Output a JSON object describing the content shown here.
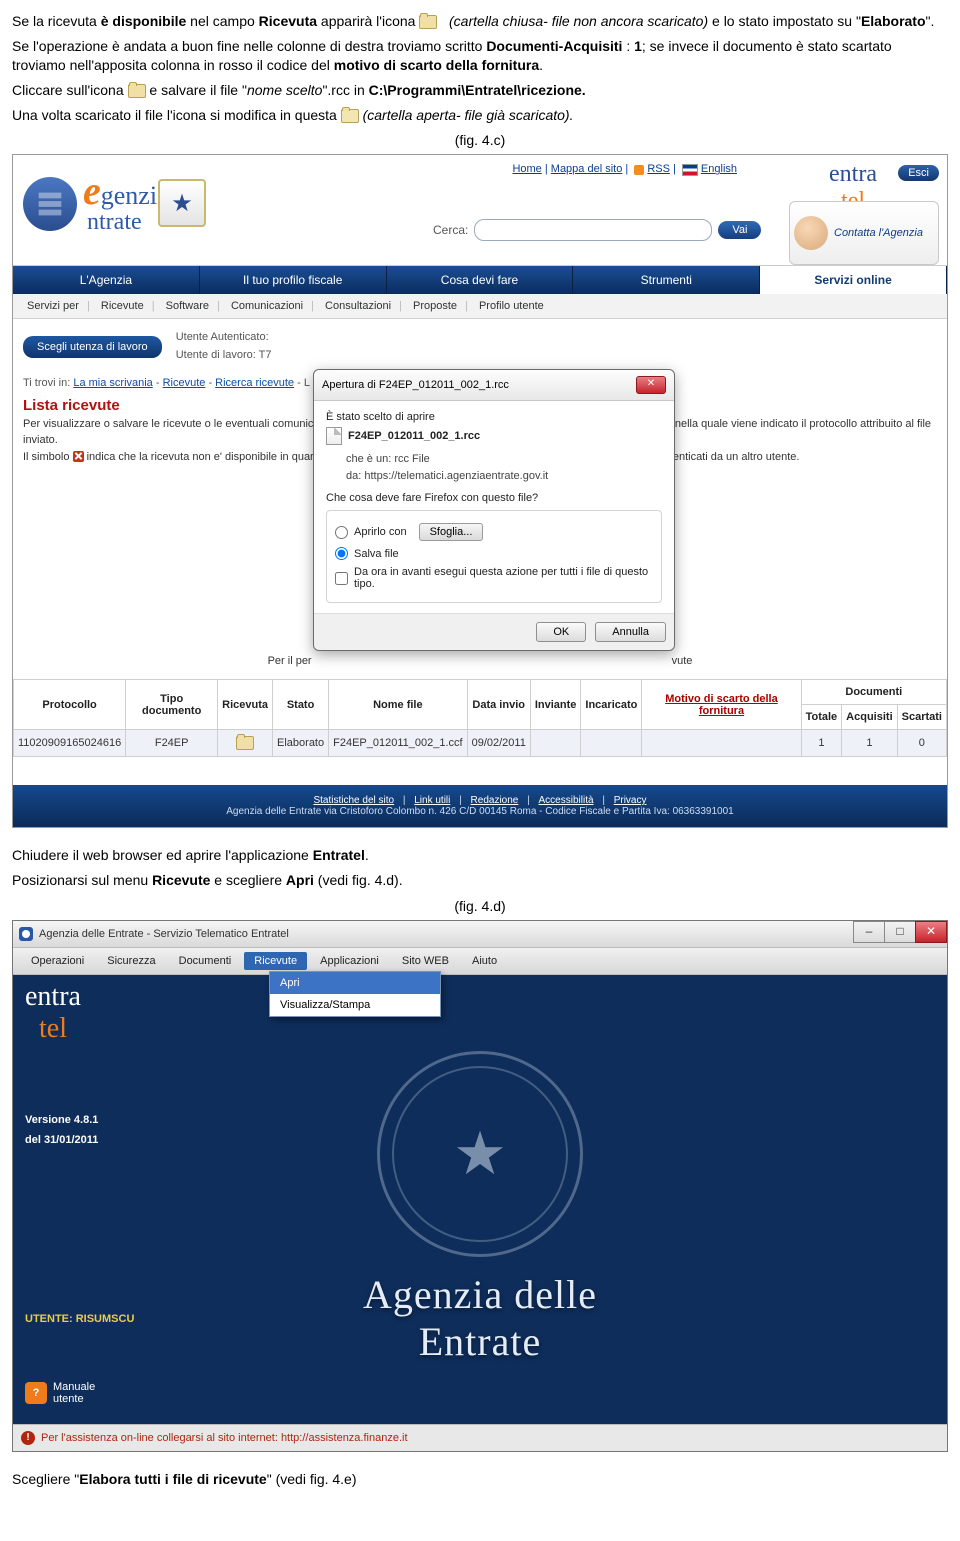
{
  "intro": {
    "p1a": "Se la ricevuta ",
    "p1b": "è disponibile",
    "p1c": " nel campo ",
    "p1d": "Ricevuta",
    "p1e": " apparirà l'icona ",
    "p1f": "(cartella chiusa- file non ancora scaricato)",
    "p1g": " e lo stato impostato su \"",
    "p1h": "Elaborato",
    "p1i": "\".",
    "p2a": "Se l'operazione è andata a buon fine nelle colonne di destra troviamo scritto ",
    "p2b": "Documenti-Acquisiti",
    "p2c": " : ",
    "p2d": "1",
    "p2e": "; se invece il documento è stato scartato troviamo nell'apposita colonna in rosso il codice del ",
    "p2f": "motivo di scarto della fornitura",
    "p2g": ".",
    "p3a": "Cliccare sull'icona ",
    "p3b": " e salvare il file \"",
    "p3c": "nome scelto",
    "p3d": "\".rcc in ",
    "p3e": "C:\\Programmi\\Entratel\\ricezione.",
    "p4a": "Una volta scaricato il file l'icona si modifica in questa ",
    "p4b": "(cartella aperta- file già scaricato)."
  },
  "figc_caption": "(fig. 4.c)",
  "top_links": {
    "home": "Home",
    "mappa": "Mappa del sito",
    "rss": "RSS",
    "english": "English"
  },
  "entra_logo": {
    "a": "entra",
    "b": "tel"
  },
  "esci": "Esci",
  "cerca_label": "Cerca:",
  "vai": "Vai",
  "contatta": "Contatta l'Agenzia",
  "navtabs": [
    "L'Agenzia",
    "Il tuo profilo fiscale",
    "Cosa devi fare",
    "Strumenti",
    "Servizi online"
  ],
  "subnav": [
    "Servizi per",
    "Ricevute",
    "Software",
    "Comunicazioni",
    "Consultazioni",
    "Proposte",
    "Profilo utente"
  ],
  "scegli": "Scegli utenza di lavoro",
  "auth": {
    "l1": "Utente Autenticato:",
    "l2": "Utente di lavoro: T7"
  },
  "breadcrumb": {
    "pre": "Ti trovi in: ",
    "a": "La mia scrivania",
    "b": "Ricevute",
    "c": "Ricerca ricevute",
    "d": " - L"
  },
  "lista_title": "Lista ricevute",
  "info": {
    "l1": "Per visualizzare o salvare le ricevute o le eventuali comunica",
    "l1b": "ga nella quale viene indicato il protocollo attribuito al file inviato.",
    "l2a": "Il simbolo ",
    "l2b": " indica che la ricevuta non e' disponibile in quar",
    "l2c": "documenti autenticati da un altro utente."
  },
  "per_line_a": "Per il per",
  "per_line_b": "vute",
  "dialog": {
    "title": "Apertura di F24EP_012011_002_1.rcc",
    "chosen": "È stato scelto di aprire",
    "file": "F24EP_012011_002_1.rcc",
    "che": "che è un:  rcc File",
    "da": "da: https://telematici.agenziaentrate.gov.it",
    "q": "Che cosa deve fare Firefox con questo file?",
    "open": "Aprirlo con",
    "sfoglia": "Sfoglia...",
    "save": "Salva file",
    "always": "Da ora in avanti esegui questa azione per tutti i file di questo tipo.",
    "ok": "OK",
    "cancel": "Annulla"
  },
  "table": {
    "headers": {
      "prot": "Protocollo",
      "tipo": "Tipo documento",
      "ric": "Ricevuta",
      "stato": "Stato",
      "nome": "Nome file",
      "data": "Data invio",
      "inv": "Inviante",
      "inc": "Incaricato",
      "mot": "Motivo di scarto della fornitura",
      "doc": "Documenti",
      "tot": "Totale",
      "acq": "Acquisiti",
      "sca": "Scartati"
    },
    "row": {
      "prot": "11020909165024616",
      "tipo": "F24EP",
      "stato": "Elaborato",
      "nome": "F24EP_012011_002_1.ccf",
      "data": "09/02/2011",
      "inv": "",
      "inc": "",
      "mot": "",
      "tot": "1",
      "acq": "1",
      "sca": "0"
    }
  },
  "footer": {
    "links": [
      "Statistiche del sito",
      "Link utili",
      "Redazione",
      "Accessibilità",
      "Privacy"
    ],
    "addr": "Agenzia delle Entrate via Cristoforo Colombo n. 426 C/D 00145 Roma - Codice Fiscale e Partita Iva: 06363391001"
  },
  "after_c": {
    "l1a": "Chiudere il web browser ed aprire l'applicazione ",
    "l1b": "Entratel",
    "l1c": ".",
    "l2a": "Posizionarsi sul menu ",
    "l2b": "Ricevute",
    "l2c": " e scegliere ",
    "l2d": "Apri",
    "l2e": " (vedi fig. 4.d)."
  },
  "figd_caption": "(fig. 4.d)",
  "desktop": {
    "title": "Agenzia delle Entrate - Servizio Telematico Entratel",
    "menu": [
      "Operazioni",
      "Sicurezza",
      "Documenti",
      "Ricevute",
      "Applicazioni",
      "Sito WEB",
      "Aiuto"
    ],
    "submenu": [
      "Apri",
      "Visualizza/Stampa"
    ],
    "brand_a": "entra",
    "brand_b": "tel",
    "ver_a": "Versione 4.8.1",
    "ver_b": "del 31/01/2011",
    "utente": "UTENTE: RISUMSCU",
    "manuale_a": "Manuale",
    "manuale_b": "utente",
    "h1a": "Agenzia delle",
    "h1b": "Entrate",
    "assist": "Per l'assistenza on-line collegarsi al sito internet: http://assistenza.finanze.it"
  },
  "final": {
    "a": "Scegliere \"",
    "b": "Elabora tutti i file di ricevute",
    "c": "\" (vedi fig. 4.e)"
  }
}
